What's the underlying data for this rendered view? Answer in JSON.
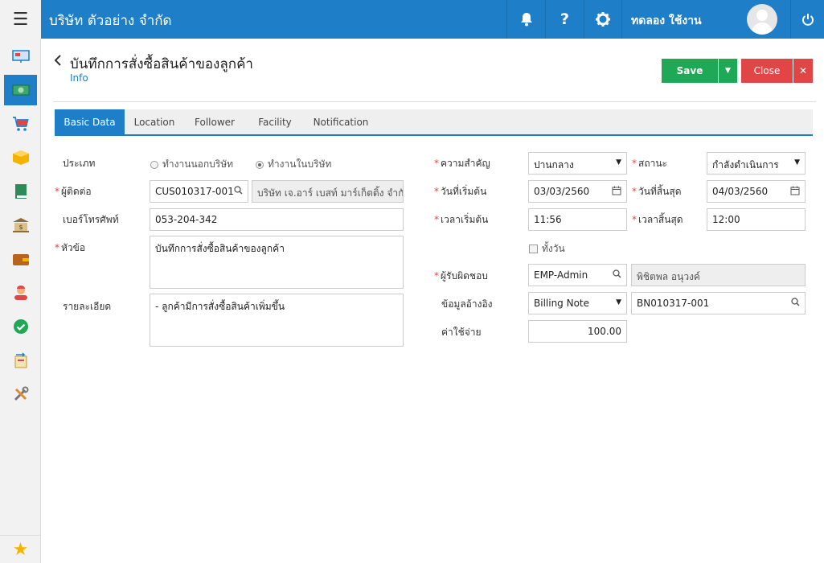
{
  "topbar": {
    "menu_icon": "hamburger-icon",
    "company": "บริษัท ตัวอย่าง จำกัด",
    "icons": [
      "bell-icon",
      "help-icon",
      "gear-icon",
      "power-icon"
    ],
    "user_name": "ทดลอง ใช้งาน"
  },
  "sidebar": {
    "items": [
      "presentation-icon",
      "money-icon",
      "cart-icon",
      "box-icon",
      "book-icon",
      "bank-icon",
      "wallet-icon",
      "user-group-icon",
      "check-circle-icon",
      "document-transfer-icon",
      "tools-icon"
    ],
    "active_index": 1,
    "favorite_icon": "star-icon"
  },
  "header": {
    "title": "บันทึกการสั่งซื้อสินค้าของลูกค้า",
    "subtitle": "Info",
    "save_label": "Save",
    "close_label": "Close"
  },
  "tabs": [
    {
      "label": "Basic Data",
      "active": true
    },
    {
      "label": "Location",
      "active": false
    },
    {
      "label": "Follower",
      "active": false
    },
    {
      "label": "Facility",
      "active": false
    },
    {
      "label": "Notification",
      "active": false
    }
  ],
  "form": {
    "type_label": "ประเภท",
    "type_options": [
      "ทำงานนอกบริษัท",
      "ทำงานในบริษัท"
    ],
    "type_selected": "ทำงานในบริษัท",
    "contact_label": "ผู้ติดต่อ",
    "contact_code": "CUS010317-001",
    "contact_name": "บริษัท เจ.อาร์ เบสท์ มาร์เก็ตติ้ง จำกั",
    "phone_label": "เบอร์โทรศัพท์",
    "phone": "053-204-342",
    "subject_label": "หัวข้อ",
    "subject": "บันทึกการสั่งซื้อสินค้าของลูกค้า",
    "detail_label": "รายละเอียด",
    "detail": "- ลูกค้ามีการสั่งซื้อสินค้าเพิ่มขึ้น",
    "priority_label": "ความสำคัญ",
    "priority": "ปานกลาง",
    "status_label": "สถานะ",
    "status": "กำลังดำเนินการ",
    "start_date_label": "วันที่เริ่มต้น",
    "start_date": "03/03/2560",
    "end_date_label": "วันที่สิ้นสุด",
    "end_date": "04/03/2560",
    "start_time_label": "เวลาเริ่มต้น",
    "start_time": "11:56",
    "end_time_label": "เวลาสิ้นสุด",
    "end_time": "12:00",
    "allday_label": "ทั้งวัน",
    "responsible_label": "ผู้รับผิดชอบ",
    "responsible_code": "EMP-Admin",
    "responsible_name": "พิชิตพล อนุวงค์",
    "reference_label": "ข้อมูลอ้างอิง",
    "reference_type": "Billing Note",
    "reference_no": "BN010317-001",
    "cost_label": "ค่าใช้จ่าย",
    "cost": "100.00"
  }
}
